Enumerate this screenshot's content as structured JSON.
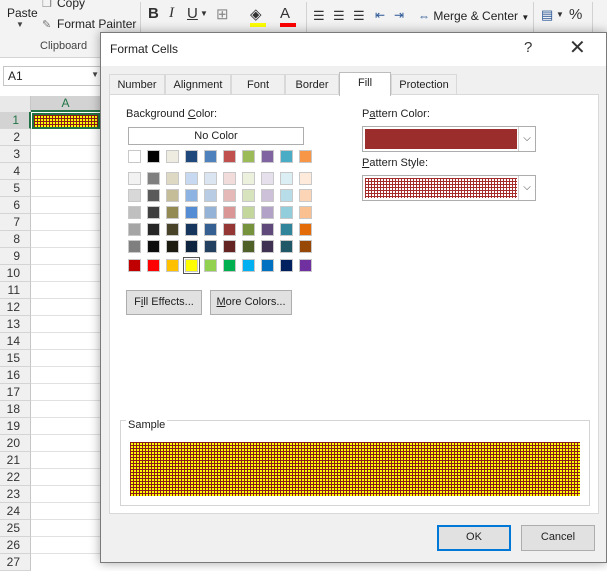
{
  "ribbon": {
    "paste_label": "Paste",
    "copy_label": "Copy",
    "format_painter_label": "Format Painter",
    "clipboard_group_label": "Clipboard",
    "bold_label": "B",
    "italic_label": "I",
    "underline_label": "U",
    "font_color_letter": "A",
    "merge_center_label": "Merge & Center",
    "percent_label": "%",
    "icons": [
      "copy-icon",
      "format-painter-icon",
      "borders-icon",
      "fill-color-icon",
      "align-left-icon",
      "align-center-icon",
      "align-right-icon",
      "decrease-indent-icon",
      "increase-indent-icon",
      "merge-icon",
      "accounting-format-icon"
    ]
  },
  "sheet": {
    "name_box": "A1",
    "column_header": "A",
    "row_headers": [
      "1",
      "2",
      "3",
      "4",
      "5",
      "6",
      "7",
      "8",
      "9",
      "10",
      "11",
      "12",
      "13",
      "14",
      "15",
      "16",
      "17",
      "18",
      "19",
      "20",
      "21",
      "22",
      "23",
      "24",
      "25",
      "26",
      "27"
    ],
    "active_row": "1"
  },
  "dialog": {
    "title": "Format Cells",
    "help_label": "?",
    "close_label": "✕",
    "tabs": [
      "Number",
      "Alignment",
      "Font",
      "Border",
      "Fill",
      "Protection"
    ],
    "active_tab": "Fill",
    "background_color": {
      "label_pre": "Background ",
      "label_key": "C",
      "label_post": "olor:",
      "no_color_label": "No Color"
    },
    "palette": {
      "standard_row": [
        "#ffffff",
        "#000000",
        "#eeece1",
        "#1f497d",
        "#4f81bd",
        "#c0504d",
        "#9bbb59",
        "#8064a2",
        "#4bacc6",
        "#f79646"
      ],
      "tint_rows": [
        [
          "#f2f2f2",
          "#7f7f7f",
          "#ddd9c3",
          "#c6d9f0",
          "#dbe5f1",
          "#f2dcdb",
          "#ebf1dd",
          "#e5e0ec",
          "#dbeef3",
          "#fdeada"
        ],
        [
          "#d8d8d8",
          "#595959",
          "#c4bd97",
          "#8db3e2",
          "#b8cce4",
          "#e5b9b7",
          "#d7e3bc",
          "#ccc1d9",
          "#b7dde8",
          "#fbd5b5"
        ],
        [
          "#bfbfbf",
          "#3f3f3f",
          "#938953",
          "#548dd4",
          "#95b3d7",
          "#d99694",
          "#c3d69b",
          "#b2a2c7",
          "#92cddc",
          "#fac08f"
        ],
        [
          "#a5a5a5",
          "#262626",
          "#494429",
          "#17365d",
          "#366092",
          "#953734",
          "#76923c",
          "#5f497a",
          "#31859b",
          "#e36c09"
        ],
        [
          "#7f7f7f",
          "#0c0c0c",
          "#1d1b10",
          "#0f243e",
          "#244061",
          "#632423",
          "#4f6128",
          "#3f3151",
          "#205867",
          "#974806"
        ]
      ],
      "bright_row": [
        "#c00000",
        "#ff0000",
        "#ffc000",
        "#ffff00",
        "#92d050",
        "#00b050",
        "#00b0f0",
        "#0070c0",
        "#002060",
        "#7030a0"
      ],
      "selected_color": "#ffff00"
    },
    "fill_effects": {
      "key": "i",
      "pre": "F",
      "post": "ll Effects..."
    },
    "more_colors": {
      "key": "M",
      "post": "ore Colors..."
    },
    "pattern_color": {
      "label_pre": "P",
      "label_key": "a",
      "label_post": "ttern Color:",
      "value": "#9b2d2d"
    },
    "pattern_style": {
      "label_key": "P",
      "label_post": "attern Style:",
      "value": "thin-grid"
    },
    "sample_label": "Sample",
    "sample_fill": "#ffff00",
    "sample_pattern_color": "#8b1a1a",
    "ok_label": "OK",
    "cancel_label": "Cancel"
  }
}
